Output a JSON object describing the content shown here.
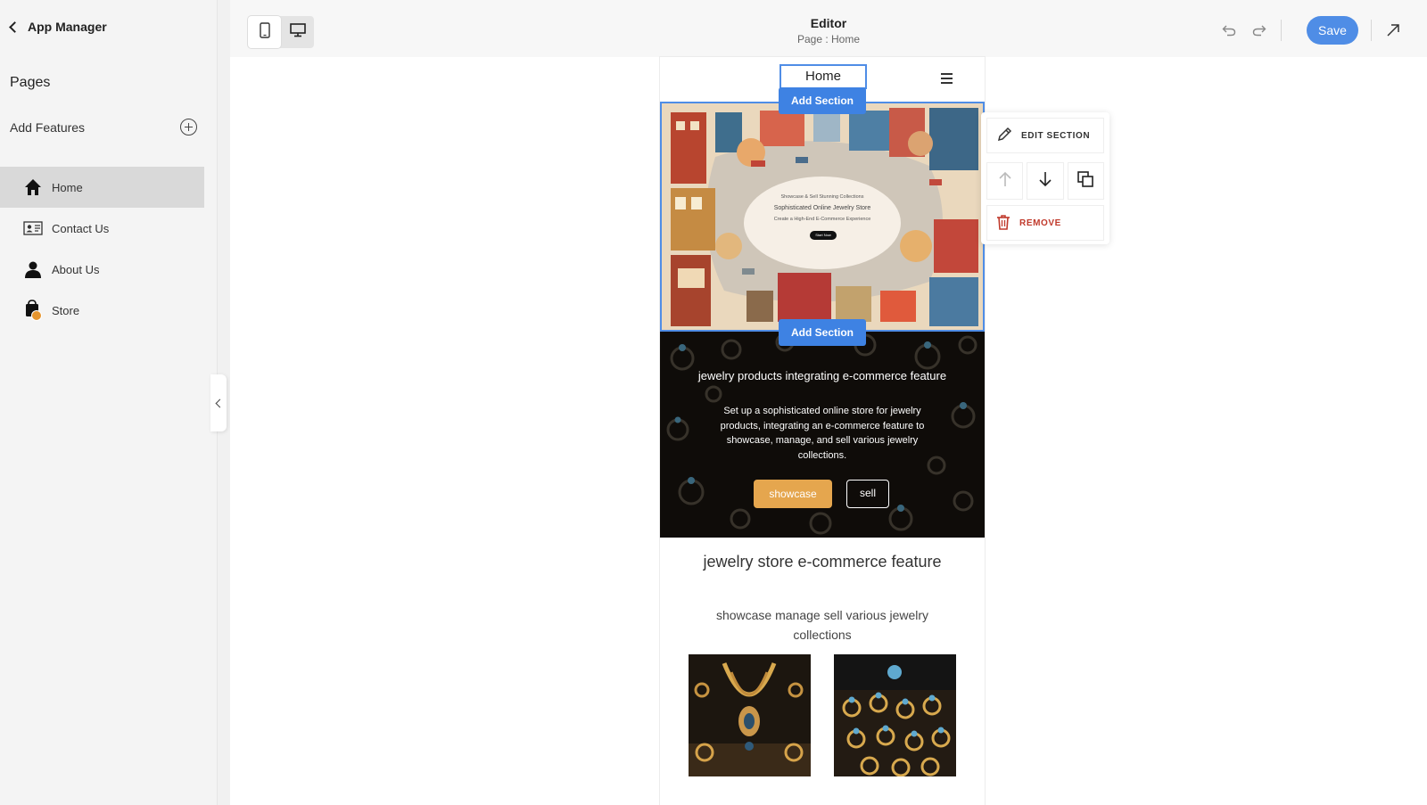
{
  "sidebar": {
    "back_label": "App Manager",
    "pages_title": "Pages",
    "add_features_label": "Add Features",
    "items": [
      {
        "label": "Home",
        "icon": "home-icon",
        "active": true
      },
      {
        "label": "Contact Us",
        "icon": "contact-card-icon",
        "active": false
      },
      {
        "label": "About Us",
        "icon": "person-icon",
        "active": false
      },
      {
        "label": "Store",
        "icon": "store-bag-icon",
        "active": false
      }
    ]
  },
  "topbar": {
    "title": "Editor",
    "subtitle": "Page : Home",
    "save_label": "Save",
    "device_modes": [
      "mobile-icon",
      "desktop-icon"
    ],
    "active_device": "mobile"
  },
  "preview": {
    "nav_home": "Home",
    "add_section_label": "Add Section",
    "hero": {
      "line1": "Showcase & Sell Stunning Collections",
      "line2": "Sophisticated Online Jewelry Store",
      "line3": "Create a High-End E-Commerce Experience",
      "button": "Start Now"
    },
    "jewelry_section": {
      "title": "jewelry products integrating e-commerce feature",
      "body": "Set up a sophisticated online store for jewelry products, integrating an e-commerce feature to showcase, manage, and sell various jewelry collections.",
      "button_primary": "showcase",
      "button_secondary": "sell"
    },
    "feature_section": {
      "title": "jewelry store e-commerce feature",
      "subtitle": "showcase manage sell various jewelry collections"
    }
  },
  "context_menu": {
    "edit_label": "EDIT SECTION",
    "remove_label": "REMOVE"
  },
  "colors": {
    "accent": "#4f8de6",
    "showcase_button": "#e5a64e",
    "remove": "#c0392b"
  }
}
